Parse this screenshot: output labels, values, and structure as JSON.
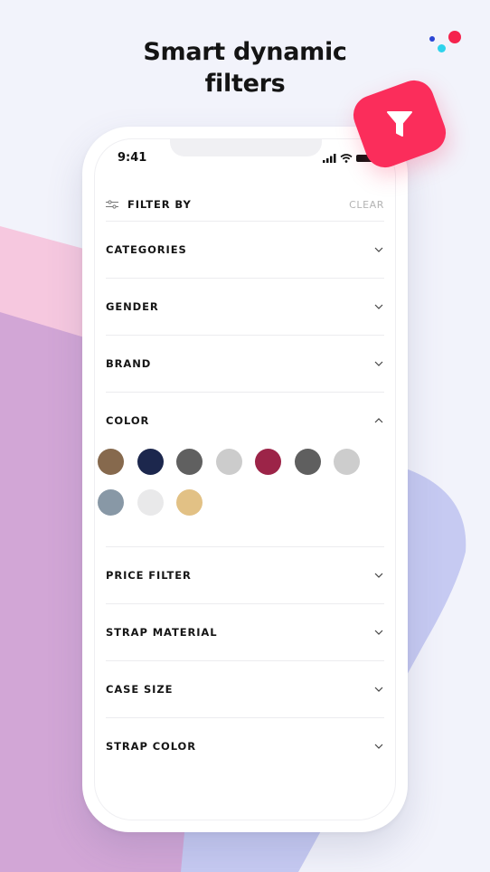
{
  "headline": {
    "line1": "Smart dynamic",
    "line2": "filters"
  },
  "colors": {
    "accent": "#fb2d5b",
    "background": "#f2f3fb",
    "deco_pink": "#f6c8df",
    "deco_purple": "#d2a6d6",
    "deco_blue": "#c6caf2",
    "dot_red": "#f5234d",
    "dot_cyan": "#2ed3ec",
    "dot_blue": "#2b45d4"
  },
  "badge": {
    "icon": "funnel-icon"
  },
  "status_bar": {
    "time": "9:41",
    "icons": [
      "signal-icon",
      "wifi-icon",
      "battery-icon"
    ]
  },
  "filter_panel": {
    "header_icon": "sliders-icon",
    "title": "FILTER BY",
    "clear_label": "CLEAR",
    "sections": [
      {
        "label": "CATEGORIES",
        "expanded": false
      },
      {
        "label": "GENDER",
        "expanded": false
      },
      {
        "label": "BRAND",
        "expanded": false
      },
      {
        "label": "COLOR",
        "expanded": true
      },
      {
        "label": "PRICE FILTER",
        "expanded": false
      },
      {
        "label": "STRAP MATERIAL",
        "expanded": false
      },
      {
        "label": "CASE SIZE",
        "expanded": false
      },
      {
        "label": "STRAP COLOR",
        "expanded": false
      }
    ],
    "color_swatches": [
      {
        "name": "brown",
        "hex": "#86694d"
      },
      {
        "name": "navy",
        "hex": "#1c274d"
      },
      {
        "name": "dark-gray",
        "hex": "#606060"
      },
      {
        "name": "light-gray",
        "hex": "#cccccc"
      },
      {
        "name": "crimson",
        "hex": "#9c2448"
      },
      {
        "name": "charcoal",
        "hex": "#5f5f5f"
      },
      {
        "name": "silver",
        "hex": "#cdcdcd"
      },
      {
        "name": "steel-blue",
        "hex": "#8898a6"
      },
      {
        "name": "off-white",
        "hex": "#e9e9ea"
      },
      {
        "name": "gold",
        "hex": "#e2c185"
      }
    ]
  }
}
